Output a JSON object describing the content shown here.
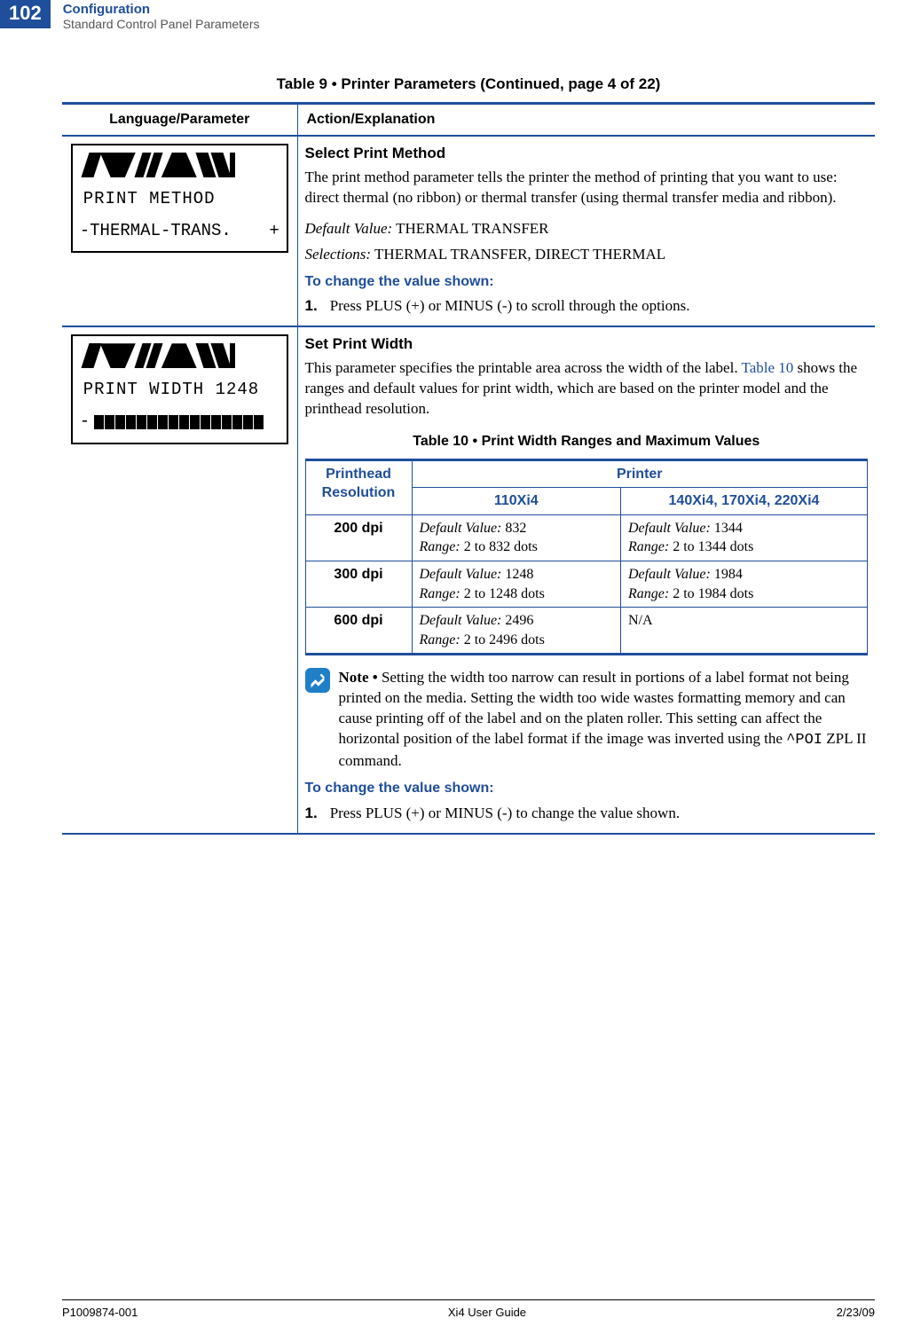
{
  "page_number": "102",
  "header": {
    "section": "Configuration",
    "subsection": "Standard Control Panel Parameters"
  },
  "table_caption": "Table 9 • Printer Parameters (Continued, page 4 of 22)",
  "columns": {
    "left": "Language/Parameter",
    "right": "Action/Explanation"
  },
  "row1": {
    "lcd_line1": "PRINT METHOD",
    "lcd_line2_prefix": "-THERMAL-TRANS.",
    "lcd_plus": "+",
    "title": "Select Print Method",
    "body": "The print method parameter tells the printer the method of printing that you want to use: direct thermal (no ribbon) or thermal transfer (using thermal transfer media and ribbon).",
    "default_label": "Default Value:",
    "default_value": " THERMAL TRANSFER",
    "selections_label": "Selections:",
    "selections_value": " THERMAL TRANSFER, DIRECT THERMAL",
    "change_heading": "To change the value shown:",
    "step_num": "1.",
    "step_text": "Press PLUS (+) or MINUS (-) to scroll through the options."
  },
  "row2": {
    "lcd_line1": "PRINT WIDTH 1248",
    "lcd_dash": "-",
    "title": "Set Print Width",
    "body_pre": "This parameter specifies the printable area across the width of the label. ",
    "body_link": "Table 10",
    "body_post": " shows the ranges and default values for print width, which are based on the printer model and the printhead resolution.",
    "sub_caption": "Table 10 • Print Width Ranges and Maximum Values",
    "sub_h1": "Printhead Resolution",
    "sub_h2": "Printer",
    "sub_h2a": "110Xi4",
    "sub_h2b": "140Xi4, 170Xi4, 220Xi4",
    "dv_label": "Default Value:",
    "rg_label": "Range:",
    "rows": [
      {
        "res": "200 dpi",
        "a_dv": " 832",
        "a_rg": " 2 to 832 dots",
        "b_dv": " 1344",
        "b_rg": " 2 to 1344 dots"
      },
      {
        "res": "300 dpi",
        "a_dv": " 1248",
        "a_rg": " 2 to 1248 dots",
        "b_dv": " 1984",
        "b_rg": " 2 to 1984 dots"
      },
      {
        "res": "600 dpi",
        "a_dv": " 2496",
        "a_rg": " 2 to 2496 dots",
        "b_na": "N/A"
      }
    ],
    "note_label": "Note • ",
    "note_pre": "Setting the width too narrow can result in portions of a label format not being printed on the media. Setting the width too wide wastes formatting memory and can cause printing off of the label and on the platen roller. This setting can affect the horizontal position of the label format if the image was inverted using the ",
    "note_code": "^POI",
    "note_post": " ZPL II command.",
    "change_heading": "To change the value shown:",
    "step_num": "1.",
    "step_text": "Press PLUS (+) or MINUS (-) to change the value shown."
  },
  "footer": {
    "left": "P1009874-001",
    "center": "Xi4 User Guide",
    "right": "2/23/09"
  },
  "chart_data": {
    "type": "table",
    "title": "Table 10 • Print Width Ranges and Maximum Values",
    "columns": [
      "Printhead Resolution",
      "110Xi4 Default Value",
      "110Xi4 Range (dots)",
      "140Xi4/170Xi4/220Xi4 Default Value",
      "140Xi4/170Xi4/220Xi4 Range (dots)"
    ],
    "rows": [
      [
        "200 dpi",
        832,
        "2 to 832",
        1344,
        "2 to 1344"
      ],
      [
        "300 dpi",
        1248,
        "2 to 1248",
        1984,
        "2 to 1984"
      ],
      [
        "600 dpi",
        2496,
        "2 to 2496",
        "N/A",
        "N/A"
      ]
    ]
  }
}
